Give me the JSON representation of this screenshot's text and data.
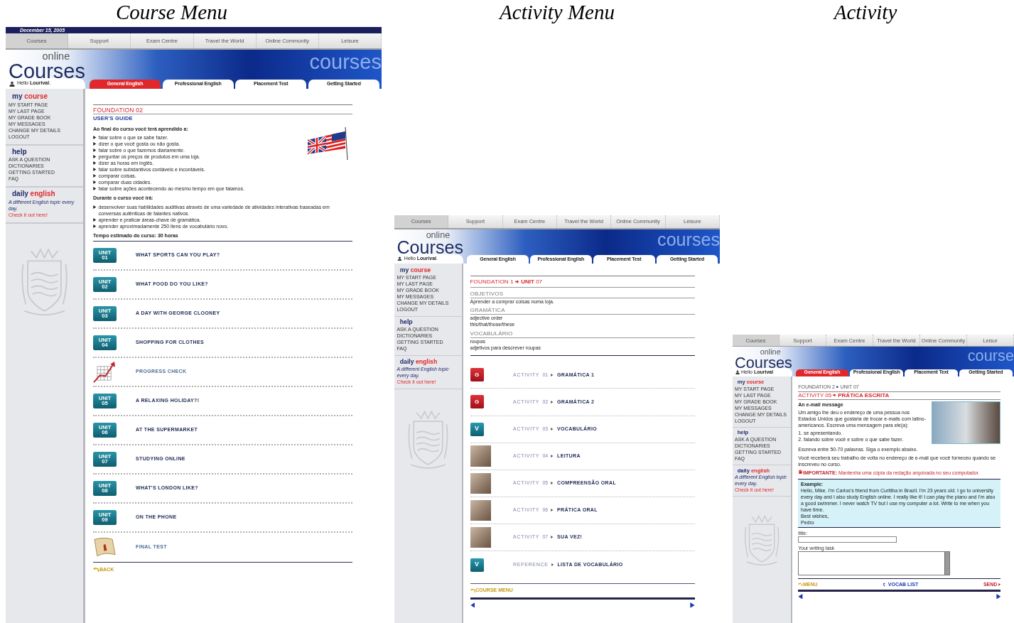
{
  "captions": [
    "Course Menu",
    "Activity Menu",
    "Activity"
  ],
  "panels": [
    {
      "date": "December 15, 2005",
      "nav": [
        {
          "label": "Courses",
          "selected": true
        },
        {
          "label": "Support",
          "selected": false
        },
        {
          "label": "Exam Centre",
          "selected": false
        },
        {
          "label": "Travel the World",
          "selected": false
        },
        {
          "label": "Online Community",
          "selected": false
        },
        {
          "label": "Leisure",
          "selected": false
        }
      ],
      "logo_small": "online",
      "logo": "Courses",
      "banner_word": "courses",
      "greeting": "Hello **Lourival**.",
      "tabs": [
        {
          "label": "General English",
          "selected": true
        },
        {
          "label": "Professional English",
          "selected": false
        },
        {
          "label": "Placement Test",
          "selected": false
        },
        {
          "label": "Getting Started",
          "selected": false
        }
      ],
      "sidebar": [
        {
          "title": "my",
          "accent": "course",
          "items": [
            "MY START PAGE",
            "MY LAST PAGE",
            "MY GRADE BOOK",
            "MY MESSAGES",
            "CHANGE MY DETAILS",
            "LOGOUT"
          ]
        },
        {
          "title": "help",
          "items": [
            "ASK A QUESTION",
            "DICTIONARIES",
            "GETTING STARTED",
            "FAQ"
          ]
        },
        {
          "title": "daily",
          "accent": "english",
          "description": "A different English topic every day.",
          "link": "Check it out here!"
        }
      ],
      "content": {
        "kind": "course_menu",
        "heading": "FOUNDATION 02",
        "subheading": "USER'S GUIDE",
        "intro": "Ao final do curso você terá aprendido a:",
        "goals": [
          "falar sobre o que se sabe fazer.",
          "dizer o que você gosta ou não gosta.",
          "falar sobre o que fazemos diariamente.",
          "perguntar os preços de produtos em uma loja.",
          "dizer as horas em inglês.",
          "falar sobre substantivos contáveis e incontáveis.",
          "comparar coisas.",
          "comparar duas cidades.",
          "falar sobre ações acontecendo ao mesmo tempo em que falamos."
        ],
        "during_intro": "Durante o curso você irá:",
        "during": [
          "desenvolver suas habilidades auditivas através de uma variedade de atividades interativas baseadas em conversas autênticas de falantes nativos.",
          "aprender e praticar áreas-chave de gramática.",
          "aprender aproximadamente 250 itens de vocabulário novo."
        ],
        "duration": "Tempo estimado do curso: 30 horas",
        "units": [
          {
            "kind": "unit",
            "badge": "UNIT",
            "number": "01",
            "title": "WHAT SPORTS CAN YOU PLAY?"
          },
          {
            "kind": "unit",
            "badge": "UNIT",
            "number": "02",
            "title": "WHAT FOOD DO YOU LIKE?"
          },
          {
            "kind": "unit",
            "badge": "UNIT",
            "number": "03",
            "title": "A DAY WITH GEORGE CLOONEY"
          },
          {
            "kind": "unit",
            "badge": "UNIT",
            "number": "04",
            "title": "SHOPPING FOR CLOTHES"
          },
          {
            "kind": "progress",
            "title": "PROGRESS CHECK"
          },
          {
            "kind": "unit",
            "badge": "UNIT",
            "number": "05",
            "title": "A RELAXING HOLIDAY?!"
          },
          {
            "kind": "unit",
            "badge": "UNIT",
            "number": "06",
            "title": "AT THE SUPERMARKET"
          },
          {
            "kind": "unit",
            "badge": "UNIT",
            "number": "07",
            "title": "STUDYING ONLINE"
          },
          {
            "kind": "unit",
            "badge": "UNIT",
            "number": "08",
            "title": "WHAT'S LONDON LIKE?"
          },
          {
            "kind": "unit",
            "badge": "UNIT",
            "number": "09",
            "title": "ON THE PHONE"
          },
          {
            "kind": "test",
            "title": "FINAL TEST"
          }
        ],
        "back": "BACK"
      }
    },
    {
      "nav": [
        {
          "label": "Courses",
          "selected": true
        },
        {
          "label": "Support",
          "selected": false
        },
        {
          "label": "Exam Centre",
          "selected": false
        },
        {
          "label": "Travel the World",
          "selected": false
        },
        {
          "label": "Online Community",
          "selected": false
        },
        {
          "label": "Leisure",
          "selected": false
        }
      ],
      "logo_small": "online",
      "logo": "Courses",
      "banner_word": "courses",
      "greeting": "Hello **Lourival**.",
      "tabs": [
        {
          "label": "General English",
          "selected": false
        },
        {
          "label": "Professional English",
          "selected": false
        },
        {
          "label": "Placement Test",
          "selected": false
        },
        {
          "label": "Getting Started",
          "selected": false
        }
      ],
      "sidebar": [
        {
          "title": "my",
          "accent": "course",
          "items": [
            "MY START PAGE",
            "MY LAST PAGE",
            "MY GRADE BOOK",
            "MY MESSAGES",
            "CHANGE MY DETAILS",
            "LOGOUT"
          ]
        },
        {
          "title": "help",
          "items": [
            "ASK A QUESTION",
            "DICTIONARIES",
            "GETTING STARTED",
            "FAQ"
          ]
        },
        {
          "title": "daily",
          "accent": "english",
          "description": "A different English topic every day.",
          "link": "Check it out here!"
        }
      ],
      "content": {
        "kind": "activity_menu",
        "foundation": "FOUNDATION 1",
        "unit": "**UNIT** 07",
        "sections": [
          {
            "title": "OBJETIVOS",
            "lines": [
              "Aprender a comprar coisas numa loja."
            ]
          },
          {
            "title": "GRAMÁTICA",
            "lines": [
              "adjective order",
              "this/that/those/these"
            ]
          },
          {
            "title": "VOCABULÁRIO",
            "lines": [
              "roupas",
              "adjetivos para descrever roupas"
            ]
          }
        ],
        "activities": [
          {
            "kind": "grammar",
            "letter": "G",
            "label": "ACTIVITY",
            "number": "01",
            "title": "GRAMÁTICA 1"
          },
          {
            "kind": "grammar",
            "letter": "G",
            "label": "ACTIVITY",
            "number": "02",
            "title": "GRAMÁTICA 2"
          },
          {
            "kind": "vocab",
            "letter": "V",
            "label": "ACTIVITY",
            "number": "03",
            "title": "VOCABULÁRIO"
          },
          {
            "kind": "photo",
            "label": "ACTIVITY",
            "number": "04",
            "title": "LEITURA"
          },
          {
            "kind": "photo",
            "label": "ACTIVITY",
            "number": "05",
            "title": "COMPREENSÃO ORAL"
          },
          {
            "kind": "photo",
            "label": "ACTIVITY",
            "number": "06",
            "title": "PRÁTICA ORAL"
          },
          {
            "kind": "photo",
            "label": "ACTIVITY",
            "number": "07",
            "title": "SUA VEZ!"
          },
          {
            "kind": "vocab",
            "letter": "V",
            "label": "REFERENCE",
            "title": "LISTA DE VOCABULÁRIO"
          }
        ],
        "back": "COURSE MENU"
      }
    },
    {
      "nav": [
        {
          "label": "Courses",
          "selected": true
        },
        {
          "label": "Support",
          "selected": false
        },
        {
          "label": "Exam Centre",
          "selected": false
        },
        {
          "label": "Travel the World",
          "selected": false
        },
        {
          "label": "Online Community",
          "selected": false
        },
        {
          "label": "Leisur",
          "selected": false
        }
      ],
      "logo_small": "online",
      "logo": "Courses",
      "banner_word": "course",
      "greeting": "Hello **Lourival**",
      "tabs": [
        {
          "label": "General English",
          "selected": true
        },
        {
          "label": "Professional English",
          "selected": false
        },
        {
          "label": "Placement Text",
          "selected": false
        },
        {
          "label": "Getting Started",
          "selected": false
        }
      ],
      "sidebar": [
        {
          "title": "my",
          "accent": "course",
          "items": [
            "MY START PAGE",
            "MY LAST PAGE",
            "MY GRADE BOOK",
            "MY MESSAGES",
            "CHANGE MY DETAILS",
            "LOGOUT"
          ]
        },
        {
          "title": "help",
          "items": [
            "ASK A QUESTION",
            "DICTIONARIES",
            "GETTING STARTED",
            "FAQ"
          ]
        },
        {
          "title": "daily",
          "accent": "english",
          "description": "A different English topic every day.",
          "link": "Check it out here!"
        }
      ],
      "content": {
        "kind": "activity",
        "breadcrumb": [
          "FOUNDATION 2",
          "UNIT 07"
        ],
        "activity_label": "ACTIVITY 05",
        "activity_title": "PRÁTICA ESCRITA",
        "subtitle": "An e-mail message",
        "paragraph": "Um amigo lhe deu o endereço de uma pessoa nos Estados Unidos que gostaria de trocar e-mails com latino-americanos. Escreva uma mensagem para ele(a):",
        "steps": [
          "1. se apresentando.",
          "2. falando sobre você e sobre o que sabe fazer."
        ],
        "instruction": "Escreva entre 50-70 palavras. Siga o exemplo abaixo.",
        "note": "Você receberá seu trabalho de volta no endereço de e-mail que você forneceu quando se inscreveu no curso.",
        "important": "**IMPORTANTE:** Mantenha uma cópia da redação arquivada no seu computador.",
        "example_title": "Example:",
        "example_body": "Hello, Mike. I'm Carlos's friend from Curitiba in Brazil. I'm 23 years old. I go to university every day and I also study English online. I really like it! I can play the piano and I'm also a good swimmer. I never watch TV but I use my computer a lot. Write to me when you have time.",
        "example_closing": [
          "Best wishes,",
          "Pedro"
        ],
        "title_label": "title:",
        "task_label": "Your writing task",
        "menu": "MENU",
        "vocab": "VOCAB LIST",
        "send": "SEND"
      }
    }
  ]
}
